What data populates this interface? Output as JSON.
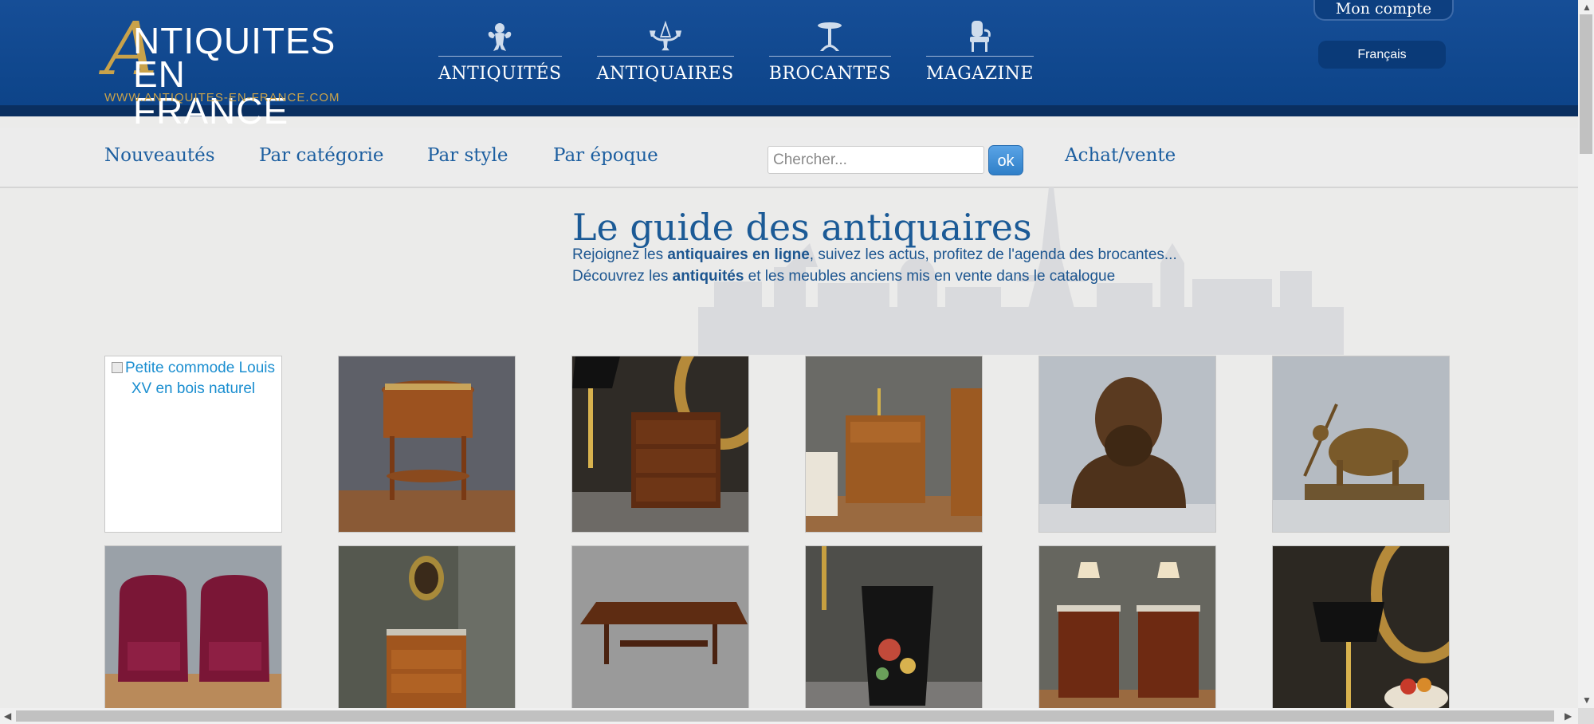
{
  "logo": {
    "line1": "NTIQUITES",
    "line2": "EN FRANCE",
    "initial": "A",
    "url": "WWW.ANTIQUITES-EN-FRANCE.COM"
  },
  "main_nav": [
    {
      "label": "ANTIQUITÉS",
      "icon": "cherub-icon"
    },
    {
      "label": "ANTIQUAIRES",
      "icon": "chandelier-icon"
    },
    {
      "label": "BROCANTES",
      "icon": "pedestal-table-icon"
    },
    {
      "label": "MAGAZINE",
      "icon": "chair-icon"
    }
  ],
  "account": {
    "label": "Mon compte"
  },
  "language": {
    "label": "Français"
  },
  "subnav": {
    "items": [
      "Nouveautés",
      "Par catégorie",
      "Par style",
      "Par époque"
    ],
    "search_placeholder": "Chercher...",
    "ok_label": "ok",
    "achat_vente": "Achat/vente"
  },
  "hero": {
    "title": "Le guide des antiquaires",
    "line1_pre": "Rejoignez les ",
    "line1_bold": "antiquaires en ligne",
    "line1_post": ", suivez les actus, profitez de l'agenda des brocantes...",
    "line2_pre": "Découvrez les ",
    "line2_bold": "antiquités",
    "line2_post": " et les meubles anciens mis en vente dans le catalogue"
  },
  "products": [
    {
      "alt": "Petite commode Louis XV en bois naturel",
      "broken": true
    },
    {
      "subject": "oval-side-table"
    },
    {
      "subject": "nightstand-with-lamp"
    },
    {
      "subject": "side-table-room"
    },
    {
      "subject": "bronze-bust"
    },
    {
      "subject": "bronze-ox-sculpture"
    },
    {
      "subject": "velvet-armchairs"
    },
    {
      "subject": "chest-of-drawers-portrait"
    },
    {
      "subject": "coffee-table"
    },
    {
      "subject": "painted-toleware-basket"
    },
    {
      "subject": "pair-of-nightstands"
    },
    {
      "subject": "bouillotte-lamp"
    }
  ]
}
